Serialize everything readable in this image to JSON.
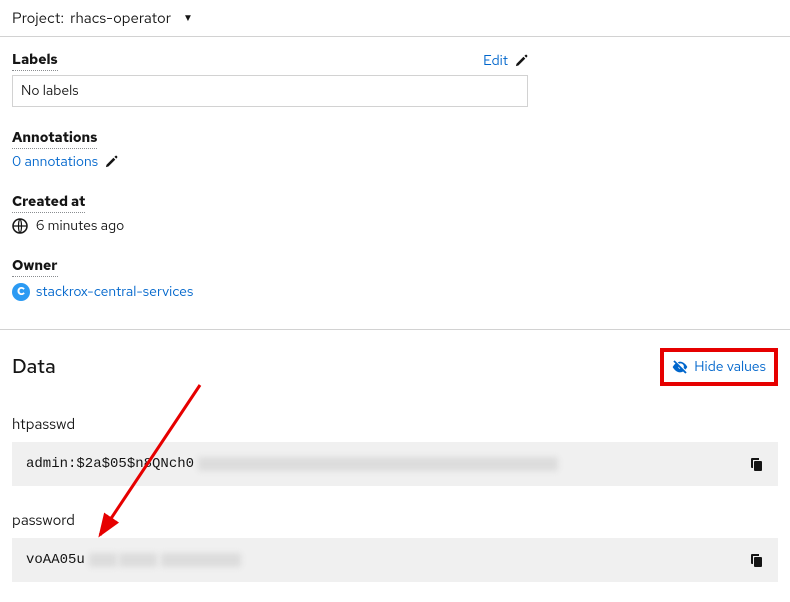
{
  "project": {
    "prefix": "Project:",
    "name": "rhacs-operator"
  },
  "labels": {
    "heading": "Labels",
    "edit": "Edit",
    "empty": "No labels"
  },
  "annotations": {
    "heading": "Annotations",
    "link": "0 annotations"
  },
  "created": {
    "heading": "Created at",
    "value": "6 minutes ago"
  },
  "owner": {
    "heading": "Owner",
    "badge": "C",
    "name": "stackrox-central-services"
  },
  "data": {
    "heading": "Data",
    "hide": "Hide values",
    "entries": [
      {
        "key": "htpasswd",
        "visible": "admin:$2a$05$n8QNch0"
      },
      {
        "key": "password",
        "visible": "voAA05u"
      }
    ]
  }
}
